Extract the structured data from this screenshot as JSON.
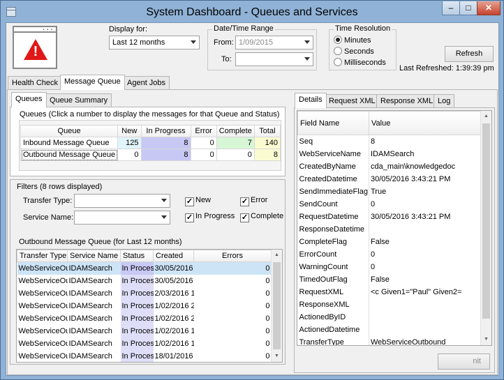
{
  "window": {
    "title": "System Dashboard - Queues and Services",
    "close_glyph": "✕",
    "min_glyph": "–",
    "max_glyph": "□"
  },
  "header": {
    "display_for_label": "Display for:",
    "display_for_value": "Last 12 months",
    "date_range": {
      "title": "Date/Time Range",
      "from_label": "From:",
      "from_value": "1/09/2015",
      "to_label": "To:",
      "to_value": ""
    },
    "time_resolution": {
      "title": "Time Resolution",
      "options": [
        "Minutes",
        "Seconds",
        "Milliseconds"
      ],
      "selected": "Minutes"
    },
    "refresh_label": "Refresh",
    "last_refreshed_label": "Last Refreshed:",
    "last_refreshed_value": "1:39:39 pm"
  },
  "main_tabs": [
    "Health Check",
    "Message Queue",
    "Agent Jobs"
  ],
  "active_main_tab": "Message Queue",
  "sub_tabs": [
    "Queues",
    "Queue Summary"
  ],
  "active_sub_tab": "Queues",
  "queues": {
    "caption": "Queues (Click a number to display the messages for that Queue and Status)",
    "columns": [
      "Queue",
      "New",
      "In Progress",
      "Error",
      "Complete",
      "Total"
    ],
    "rows": [
      {
        "queue": "Inbound Message Queue",
        "new": "125",
        "in_progress": "8",
        "error": "0",
        "complete": "7",
        "total": "140"
      },
      {
        "queue": "Outbound Message Queue",
        "new": "0",
        "in_progress": "8",
        "error": "0",
        "complete": "0",
        "total": "8"
      }
    ]
  },
  "filters": {
    "caption": "Filters",
    "rows_displayed": "(8 rows displayed)",
    "transfer_type_label": "Transfer Type:",
    "service_name_label": "Service Name:",
    "checkboxes": [
      {
        "label": "New",
        "checked": true
      },
      {
        "label": "Error",
        "checked": true
      },
      {
        "label": "In Progress",
        "checked": true
      },
      {
        "label": "Complete",
        "checked": true
      }
    ]
  },
  "outbound": {
    "caption": "Outbound Message Queue (for Last 12 months)",
    "columns": [
      "Transfer Type",
      "Service Name",
      "Status",
      "Created",
      "Errors"
    ],
    "rows": [
      {
        "transfer_type": "WebServiceOu",
        "service": "IDAMSearch",
        "status": "In Proces",
        "created": "30/05/2016",
        "errors": "0"
      },
      {
        "transfer_type": "WebServiceOu",
        "service": "IDAMSearch",
        "status": "In Proces",
        "created": "30/05/2016",
        "errors": "0"
      },
      {
        "transfer_type": "WebServiceOu",
        "service": "IDAMSearch",
        "status": "In Proces",
        "created": "2/03/2016 1",
        "errors": "0"
      },
      {
        "transfer_type": "WebServiceOu",
        "service": "IDAMSearch",
        "status": "In Proces",
        "created": "1/02/2016 2",
        "errors": "0"
      },
      {
        "transfer_type": "WebServiceOu",
        "service": "IDAMSearch",
        "status": "In Proces",
        "created": "1/02/2016 2",
        "errors": "0"
      },
      {
        "transfer_type": "WebServiceOu",
        "service": "IDAMSearch",
        "status": "In Proces",
        "created": "1/02/2016 1",
        "errors": "0"
      },
      {
        "transfer_type": "WebServiceOu",
        "service": "IDAMSearch",
        "status": "In Proces",
        "created": "1/02/2016 1",
        "errors": "0"
      },
      {
        "transfer_type": "WebServiceOu",
        "service": "IDAMSearch",
        "status": "In Proces",
        "created": "18/01/2016",
        "errors": "0"
      }
    ]
  },
  "detail_tabs": [
    "Details",
    "Request XML",
    "Response XML",
    "Log"
  ],
  "active_detail_tab": "Details",
  "details": {
    "columns": [
      "Field Name",
      "Value"
    ],
    "rows": [
      {
        "field": "Seq",
        "value": "8"
      },
      {
        "field": "WebServiceName",
        "value": "IDAMSearch"
      },
      {
        "field": "CreatedByName",
        "value": "cda_main\\knowledgedoc"
      },
      {
        "field": "CreatedDatetime",
        "value": "30/05/2016 3:43:21 PM"
      },
      {
        "field": "SendImmediateFlag",
        "value": "True"
      },
      {
        "field": "SendCount",
        "value": "0"
      },
      {
        "field": "RequestDatetime",
        "value": "30/05/2016 3:43:21 PM"
      },
      {
        "field": "ResponseDatetime",
        "value": ""
      },
      {
        "field": "CompleteFlag",
        "value": "False"
      },
      {
        "field": "ErrorCount",
        "value": "0"
      },
      {
        "field": "WarningCount",
        "value": "0"
      },
      {
        "field": "TimedOutFlag",
        "value": "False"
      },
      {
        "field": "RequestXML",
        "value": "<c Given1=\"Paul\" Given2="
      },
      {
        "field": "ResponseXML",
        "value": ""
      },
      {
        "field": "ActionedByID",
        "value": ""
      },
      {
        "field": "ActionedDatetime",
        "value": ""
      },
      {
        "field": "TransferType",
        "value": "WebServiceOutbound"
      }
    ],
    "commit_label": "nit"
  },
  "colors": {
    "title_bar": "#8fb2d6",
    "new_cell": "#e1f4fc",
    "in_progress_cell": "#c8c8f4",
    "complete_cell": "#d6f6d6",
    "total_cell": "#fbfbd2",
    "selected_row": "#cde4f7",
    "alert_red": "#e01818"
  }
}
